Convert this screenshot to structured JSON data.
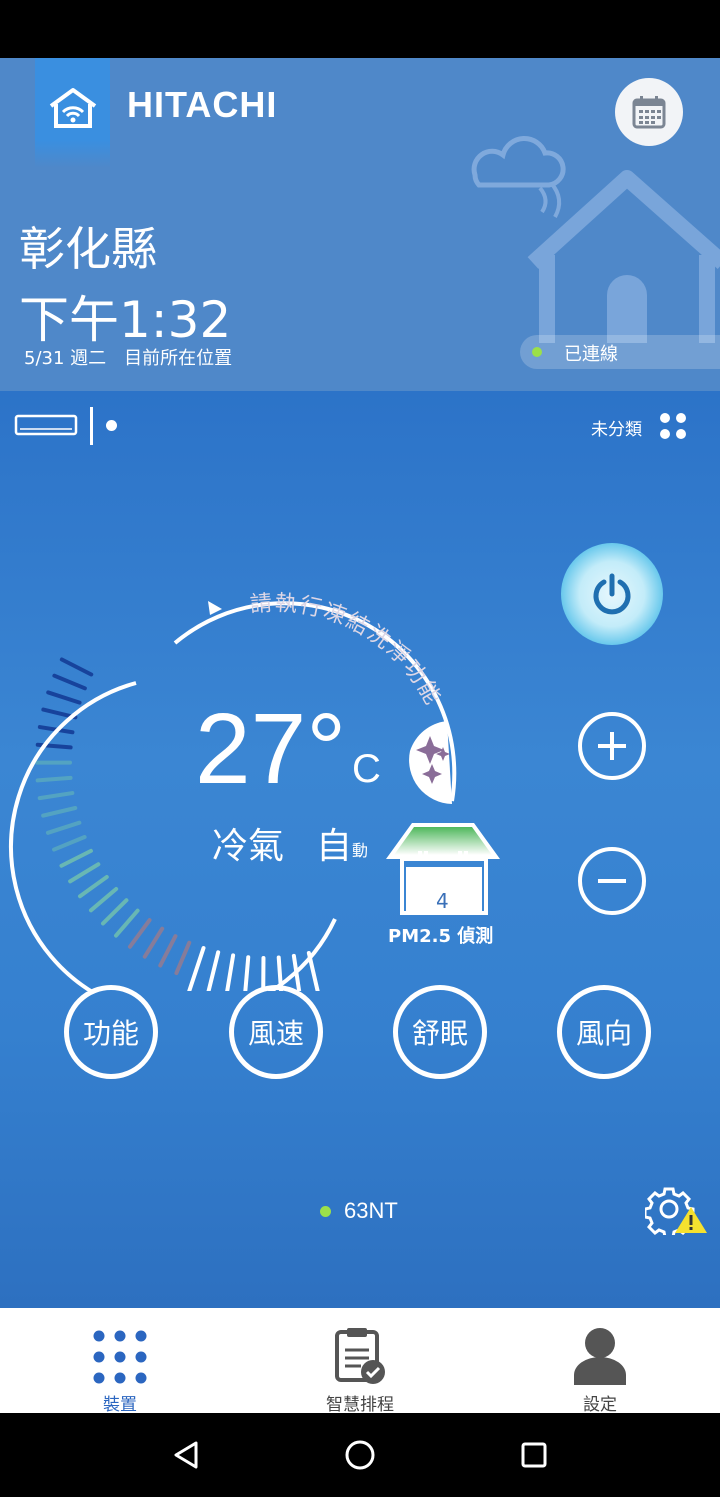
{
  "header": {
    "brand": "HITACHI",
    "location_city": "彰化縣",
    "time": "下午1:32",
    "date_line": "5/31 週二　目前所在位置",
    "connection_status": "已連線",
    "connection_color": "#9be04a"
  },
  "device_bar": {
    "category": "未分類"
  },
  "control": {
    "temperature": "27°",
    "unit": "C",
    "mode": "冷氣",
    "fan_mode_main": "自",
    "fan_mode_sub": "動",
    "arc_message": "請執行凍結洗淨功能",
    "pm25_value": "4",
    "pm25_label": "PM2.5 偵測"
  },
  "buttons": {
    "function": "功能",
    "fan_speed": "風速",
    "sleep": "舒眠",
    "direction": "風向"
  },
  "device": {
    "name": "63NT",
    "status_color": "#9be04a"
  },
  "nav": {
    "items": [
      {
        "label": "裝置",
        "icon": "grid-dots-icon",
        "active": true
      },
      {
        "label": "智慧排程",
        "icon": "schedule-clipboard-icon",
        "active": false
      },
      {
        "label": "設定",
        "icon": "person-icon",
        "active": false
      }
    ]
  },
  "colors": {
    "header_bg": "#4f88c9",
    "main_bg": "#3580cf",
    "accent": "#2b66c0",
    "power_glow": "#59c2ea"
  }
}
